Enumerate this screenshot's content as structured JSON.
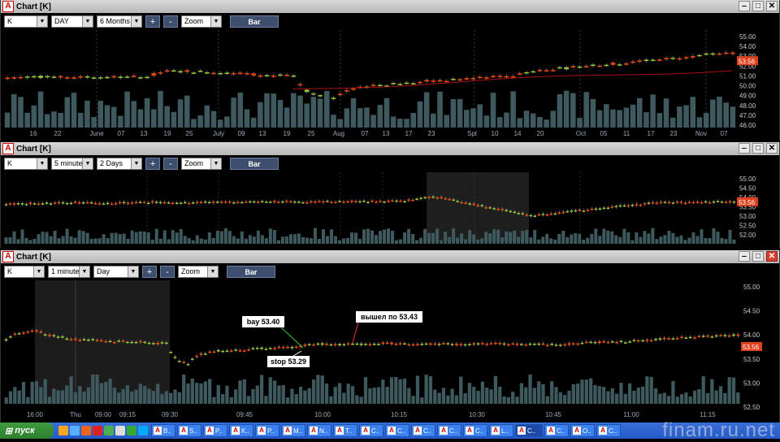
{
  "windows": [
    {
      "title": "Chart [K]",
      "symbol": "K",
      "interval": "DAY",
      "range": "6 Months",
      "plus": "+",
      "minus": "-",
      "zoom": "Zoom",
      "bar": "Bar",
      "price_labels": [
        "55.00",
        "54.00",
        "53.00",
        "52.00",
        "51.00",
        "50.00",
        "49.00",
        "48.00",
        "47.00",
        "46.00"
      ],
      "last_price": "53.56",
      "x_labels": [
        "16",
        "22",
        "June",
        "07",
        "13",
        "19",
        "25",
        "July",
        "09",
        "13",
        "19",
        "25",
        "Aug",
        "07",
        "13",
        "17",
        "23",
        "Spt",
        "10",
        "14",
        "20",
        "Oct",
        "05",
        "11",
        "17",
        "23",
        "Nov",
        "07"
      ],
      "colors": {
        "up": "#9acd32",
        "down": "#ff4500",
        "volume": "#3e5a5e",
        "ma": "#b01010"
      }
    },
    {
      "title": "Chart [K]",
      "symbol": "K",
      "interval": "5 minutes",
      "range": "2 Days",
      "plus": "+",
      "minus": "-",
      "zoom": "Zoom",
      "bar": "Bar",
      "price_labels": [
        "55.00",
        "54.50",
        "54.00",
        "53.50",
        "53.00",
        "52.50",
        "52.00"
      ],
      "last_price": "53.56"
    },
    {
      "title": "Chart [K]",
      "symbol": "K",
      "interval": "1 minute",
      "range": "Day",
      "plus": "+",
      "minus": "-",
      "zoom": "Zoom",
      "bar": "Bar",
      "price_labels": [
        "55.00",
        "54.50",
        "54.00",
        "53.50",
        "53.00",
        "52.50"
      ],
      "last_price": "53.56",
      "x_labels": [
        "16:00",
        "Thu",
        "09:00",
        "09:15",
        "09:30",
        "09:45",
        "10:00",
        "10:15",
        "10:30",
        "10:45",
        "11:00",
        "11:15"
      ],
      "annotations": {
        "buy": "bay 53.40",
        "stop": "stop 53.29",
        "exit": "вышел по 53.43"
      }
    }
  ],
  "taskbar": {
    "start": "пуск",
    "tasks": [
      "B..",
      "S..",
      "P..",
      "K..",
      "P..",
      "M..",
      "N..",
      "T..",
      "C..",
      "C..",
      "C..",
      "C..",
      "C..",
      "L..",
      "C..",
      "C..",
      "O..",
      "C.."
    ]
  },
  "watermark": "finam.ru.net"
}
